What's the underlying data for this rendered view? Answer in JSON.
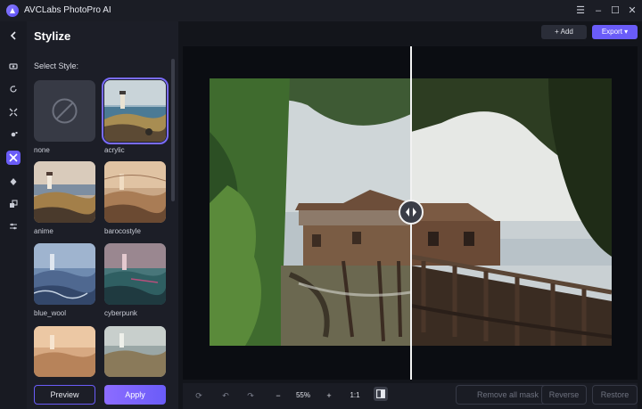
{
  "app": {
    "title": "AVCLabs PhotoPro AI"
  },
  "window_controls": {
    "menu": "☰",
    "minimize": "–",
    "maximize": "☐",
    "close": "✕"
  },
  "rail": {
    "items": [
      {
        "name": "back-icon"
      },
      {
        "name": "eraser-icon"
      },
      {
        "name": "rotate-icon"
      },
      {
        "name": "expand-icon"
      },
      {
        "name": "portrait-icon"
      },
      {
        "name": "stylize-icon",
        "active": true
      },
      {
        "name": "color-icon"
      },
      {
        "name": "layers-icon"
      },
      {
        "name": "adjust-icon"
      }
    ]
  },
  "panel": {
    "title": "Stylize",
    "section_label": "Select Style:",
    "styles": [
      {
        "label": "none",
        "selected": false
      },
      {
        "label": "acrylic",
        "selected": true
      },
      {
        "label": "anime",
        "selected": false
      },
      {
        "label": "barocostyle",
        "selected": false
      },
      {
        "label": "blue_wool",
        "selected": false
      },
      {
        "label": "cyberpunk",
        "selected": false
      },
      {
        "label": "",
        "selected": false
      },
      {
        "label": "",
        "selected": false
      }
    ],
    "preview_label": "Preview",
    "apply_label": "Apply"
  },
  "header": {
    "add_label": "+ Add",
    "export_label": "Export"
  },
  "toolbar": {
    "zoom": "55%",
    "minus": "−",
    "plus": "+",
    "ratio": "1:1",
    "remove_all_mask": "Remove all mask",
    "reverse": "Reverse",
    "restore": "Restore"
  },
  "colors": {
    "accent": "#6a5cf8",
    "background": "#14161d",
    "panel": "#1c1e27"
  }
}
